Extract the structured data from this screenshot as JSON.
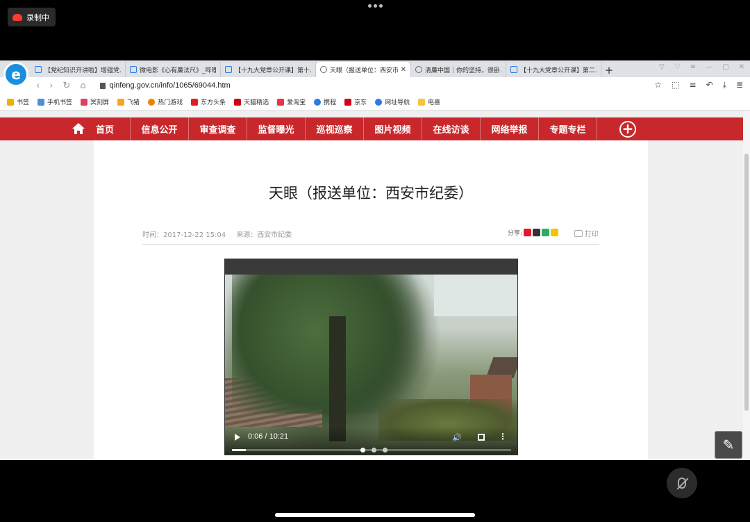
{
  "recording": {
    "label": "录制中"
  },
  "tabs": [
    {
      "title": "【党纪知识开讲啦】增强党…",
      "icon": "tv-icon"
    },
    {
      "title": "微电影《心有廉法尺》_哔哩…",
      "icon": "tv-icon"
    },
    {
      "title": "【十九大党章公开课】第十…",
      "icon": "tv-icon"
    },
    {
      "title": "天眼（报送单位：西安市…",
      "icon": "globe-icon",
      "active": true
    },
    {
      "title": "清廉中国｜你的坚持，很卧…",
      "icon": "globe-icon"
    },
    {
      "title": "【十九大党章公开课】第二…",
      "icon": "tv-icon"
    }
  ],
  "address": {
    "url": "qinfeng.gov.cn/info/1065/69044.htm"
  },
  "bookmarks": [
    {
      "label": "书签",
      "color": "#f0b000"
    },
    {
      "label": "手机书签",
      "color": "#4a90d9"
    },
    {
      "label": "冥刻屏",
      "color": "#e04060"
    },
    {
      "label": "飞猪",
      "color": "#f5a623"
    },
    {
      "label": "热门游戏",
      "color": "#f08000"
    },
    {
      "label": "东方头条",
      "color": "#e02020"
    },
    {
      "label": "天猫精选",
      "color": "#d0021b"
    },
    {
      "label": "爱淘宝",
      "color": "#e8354a"
    },
    {
      "label": "携程",
      "color": "#2a7ae2"
    },
    {
      "label": "京东",
      "color": "#d0021b"
    },
    {
      "label": "网址导航",
      "color": "#2a7ae2"
    },
    {
      "label": "电喜",
      "color": "#f5c242"
    }
  ],
  "site_nav": {
    "items": [
      "首页",
      "信息公开",
      "审查调查",
      "监督曝光",
      "巡视巡察",
      "图片视频",
      "在线访谈",
      "网络举报",
      "专题专栏"
    ],
    "brand_color": "#c8282b"
  },
  "article": {
    "title": "天眼（报送单位：西安市纪委）",
    "time_label": "时间：2017-12-22 15:04",
    "source_label": "来源：西安市纪委",
    "share_label": "分享:",
    "print_label": "打印"
  },
  "video": {
    "time": "0:06 / 10:21",
    "progress": 0.0096
  }
}
